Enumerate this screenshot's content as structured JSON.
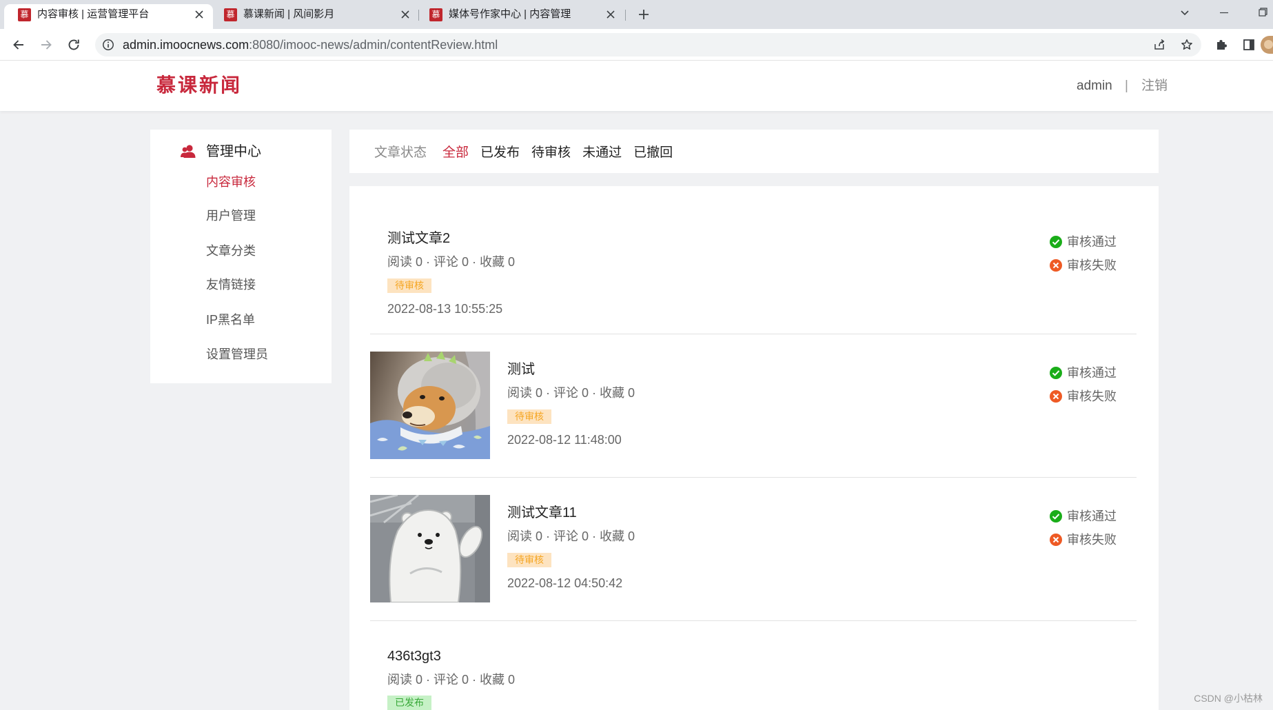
{
  "browser": {
    "favicon_glyph": "慕",
    "active_tab": 0,
    "tabs": [
      {
        "title": "内容审核 | 运营管理平台"
      },
      {
        "title": "慕课新闻 | 风间影月"
      },
      {
        "title": "媒体号作家中心 | 内容管理"
      }
    ],
    "url": {
      "host": "admin.imoocnews.com",
      "path": ":8080/imooc-news/admin/contentReview.html"
    }
  },
  "header": {
    "logo": "慕课新闻",
    "user": "admin",
    "separator": "|",
    "logout": "注销"
  },
  "sidebar": {
    "title": "管理中心",
    "active_index": 0,
    "items": [
      "内容审核",
      "用户管理",
      "文章分类",
      "友情链接",
      "IP黑名单",
      "设置管理员"
    ]
  },
  "filter": {
    "label": "文章状态",
    "active_index": 0,
    "options": [
      "全部",
      "已发布",
      "待审核",
      "未通过",
      "已撤回"
    ]
  },
  "articles": [
    {
      "title": "测试文章2",
      "stats": "阅读 0 · 评论 0 · 收藏 0",
      "status": "待审核",
      "badge_bg": "#fde3c0",
      "badge_color": "#f5a623",
      "time": "2022-08-13 10:55:25",
      "actions": [
        "审核通过",
        "审核失败"
      ]
    },
    {
      "title": "测试",
      "stats": "阅读 0 · 评论 0 · 收藏 0",
      "status": "待审核",
      "badge_bg": "#fde3c0",
      "badge_color": "#f5a623",
      "time": "2022-08-12 11:48:00",
      "actions": [
        "审核通过",
        "审核失败"
      ]
    },
    {
      "title": "测试文章11",
      "stats": "阅读 0 · 评论 0 · 收藏 0",
      "status": "待审核",
      "badge_bg": "#fde3c0",
      "badge_color": "#f5a623",
      "time": "2022-08-12 04:50:42",
      "actions": [
        "审核通过",
        "审核失败"
      ]
    },
    {
      "title": "436t3gt3",
      "stats": "阅读 0 · 评论 0 · 收藏 0",
      "status": "已发布",
      "badge_bg": "#c6f1c6",
      "badge_color": "#38a838"
    }
  ],
  "watermark": "CSDN @小枯林",
  "colors": {
    "accent": "#c8283c",
    "approve": "#1aad19",
    "reject": "#ee5a24",
    "page_bg": "#f0f1f3"
  }
}
